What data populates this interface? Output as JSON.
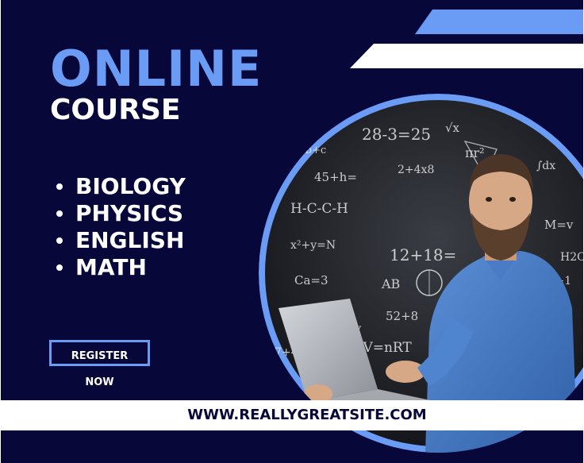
{
  "title": "ONLINE",
  "subtitle": "COURSE",
  "subjects": [
    "BIOLOGY",
    "PHYSICS",
    "ENGLISH",
    "MATH"
  ],
  "register_label": "REGISTER NOW",
  "website": "WWW.REALLYGREATSITE.COM",
  "colors": {
    "background": "#07073a",
    "accent": "#6a9cf5",
    "white": "#ffffff"
  }
}
